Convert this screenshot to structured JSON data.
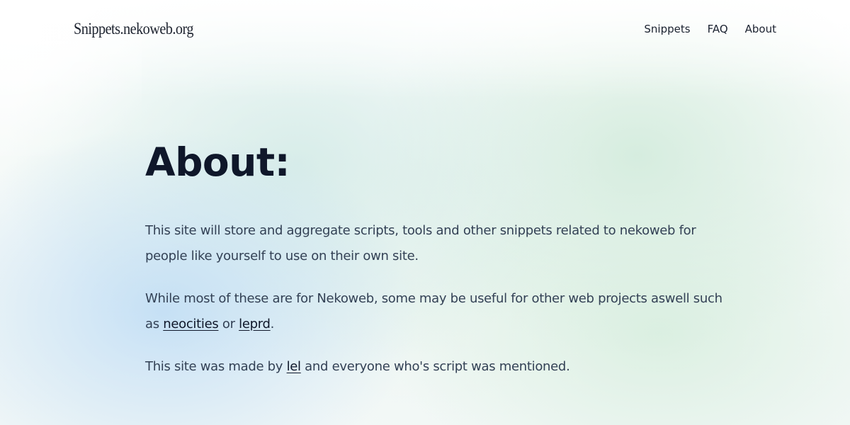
{
  "site": {
    "logo": "Snippets.nekoweb.org"
  },
  "nav": {
    "items": [
      {
        "label": "Snippets"
      },
      {
        "label": "FAQ"
      },
      {
        "label": "About"
      }
    ]
  },
  "main": {
    "heading": "About:",
    "paragraph1": "This site will store and aggregate scripts, tools and other snippets related to nekoweb for people like yourself to use on their own site.",
    "paragraph2": {
      "before": "While most of these are for Nekoweb, some may be useful for other web projects aswell such as ",
      "link1": "neocities",
      "middle": " or ",
      "link2": "leprd",
      "after": "."
    },
    "paragraph3": {
      "before": "This site was made by ",
      "link": "lel",
      "after": " and everyone who's script was mentioned."
    }
  }
}
